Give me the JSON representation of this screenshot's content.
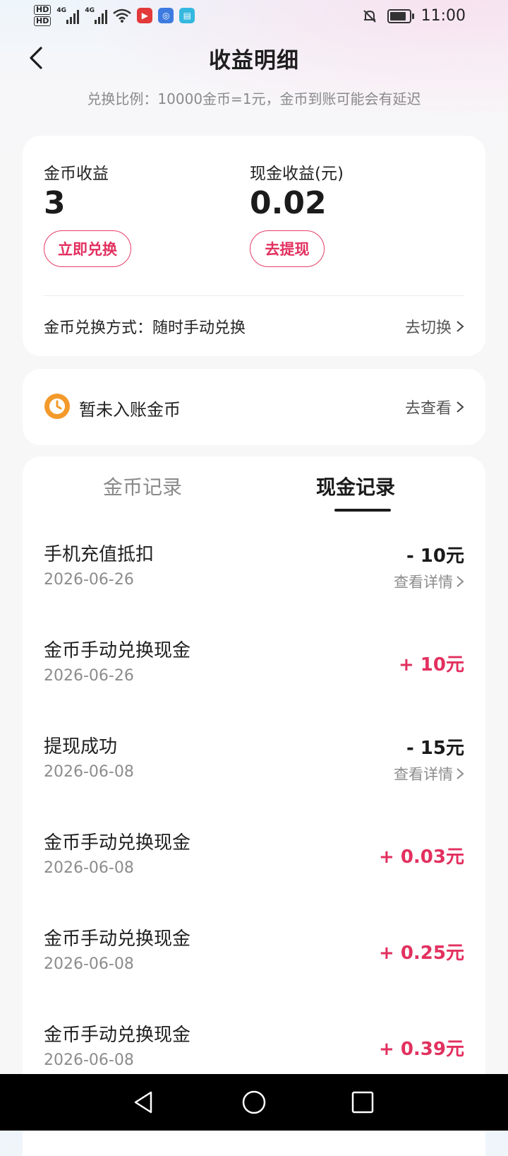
{
  "status_bar": {
    "hd1": "HD",
    "hd2": "HD",
    "net1": "4G",
    "net2": "4G",
    "time": "11:00",
    "battery_level": 0.85
  },
  "header": {
    "title": "收益明细",
    "ratio_text": "兑换比例：10000金币=1元，金币到账可能会有延迟"
  },
  "earnings": {
    "coin_label": "金币收益",
    "coin_value": "3",
    "exchange_button": "立即兑换",
    "cash_label": "现金收益(元)",
    "cash_value": "0.02",
    "withdraw_button": "去提现",
    "mode_label": "金币兑换方式：随时手动兑换",
    "mode_switch": "去切换"
  },
  "pending": {
    "label": "暂未入账金币",
    "link": "去查看"
  },
  "tabs": {
    "coin": "金币记录",
    "cash": "现金记录"
  },
  "records": [
    {
      "title": "手机充值抵扣",
      "date": "2026-06-26",
      "amount": "- 10元",
      "type": "neg",
      "detail": "查看详情"
    },
    {
      "title": "金币手动兑换现金",
      "date": "2026-06-26",
      "amount": "+ 10元",
      "type": "pos",
      "detail": ""
    },
    {
      "title": "提现成功",
      "date": "2026-06-08",
      "amount": "- 15元",
      "type": "neg",
      "detail": "查看详情"
    },
    {
      "title": "金币手动兑换现金",
      "date": "2026-06-08",
      "amount": "+ 0.03元",
      "type": "pos",
      "detail": ""
    },
    {
      "title": "金币手动兑换现金",
      "date": "2026-06-08",
      "amount": "+ 0.25元",
      "type": "pos",
      "detail": ""
    },
    {
      "title": "金币手动兑换现金",
      "date": "2026-06-08",
      "amount": "+ 0.39元",
      "type": "pos",
      "detail": ""
    }
  ],
  "colors": {
    "accent": "#e2305f",
    "clock_icon": "#f39a2b"
  }
}
